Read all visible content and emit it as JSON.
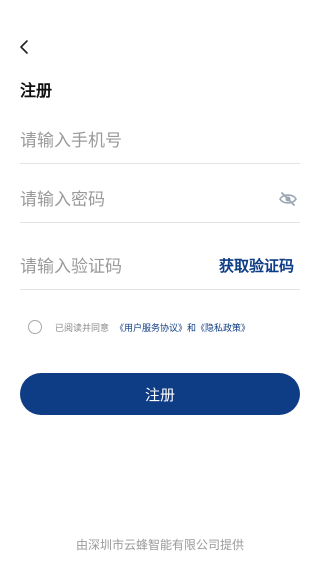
{
  "nav": {
    "back_icon": "chevron-left-icon"
  },
  "page": {
    "title": "注册"
  },
  "form": {
    "phone_placeholder": "请输入手机号",
    "password_placeholder": "请输入密码",
    "password_toggle_icon": "eye-off-icon",
    "code_placeholder": "请输入验证码",
    "get_code_label": "获取验证码"
  },
  "agreement": {
    "prefix": "已阅读并同意",
    "user_agreement": "《用户服务协议》",
    "and": "和",
    "privacy_policy": "《隐私政策》"
  },
  "actions": {
    "register_label": "注册"
  },
  "footer": {
    "text": "由深圳市云蜂智能有限公司提供"
  },
  "colors": {
    "primary": "#0e3c85",
    "placeholder": "#9a9a9a",
    "divider": "#e2e2e2"
  }
}
